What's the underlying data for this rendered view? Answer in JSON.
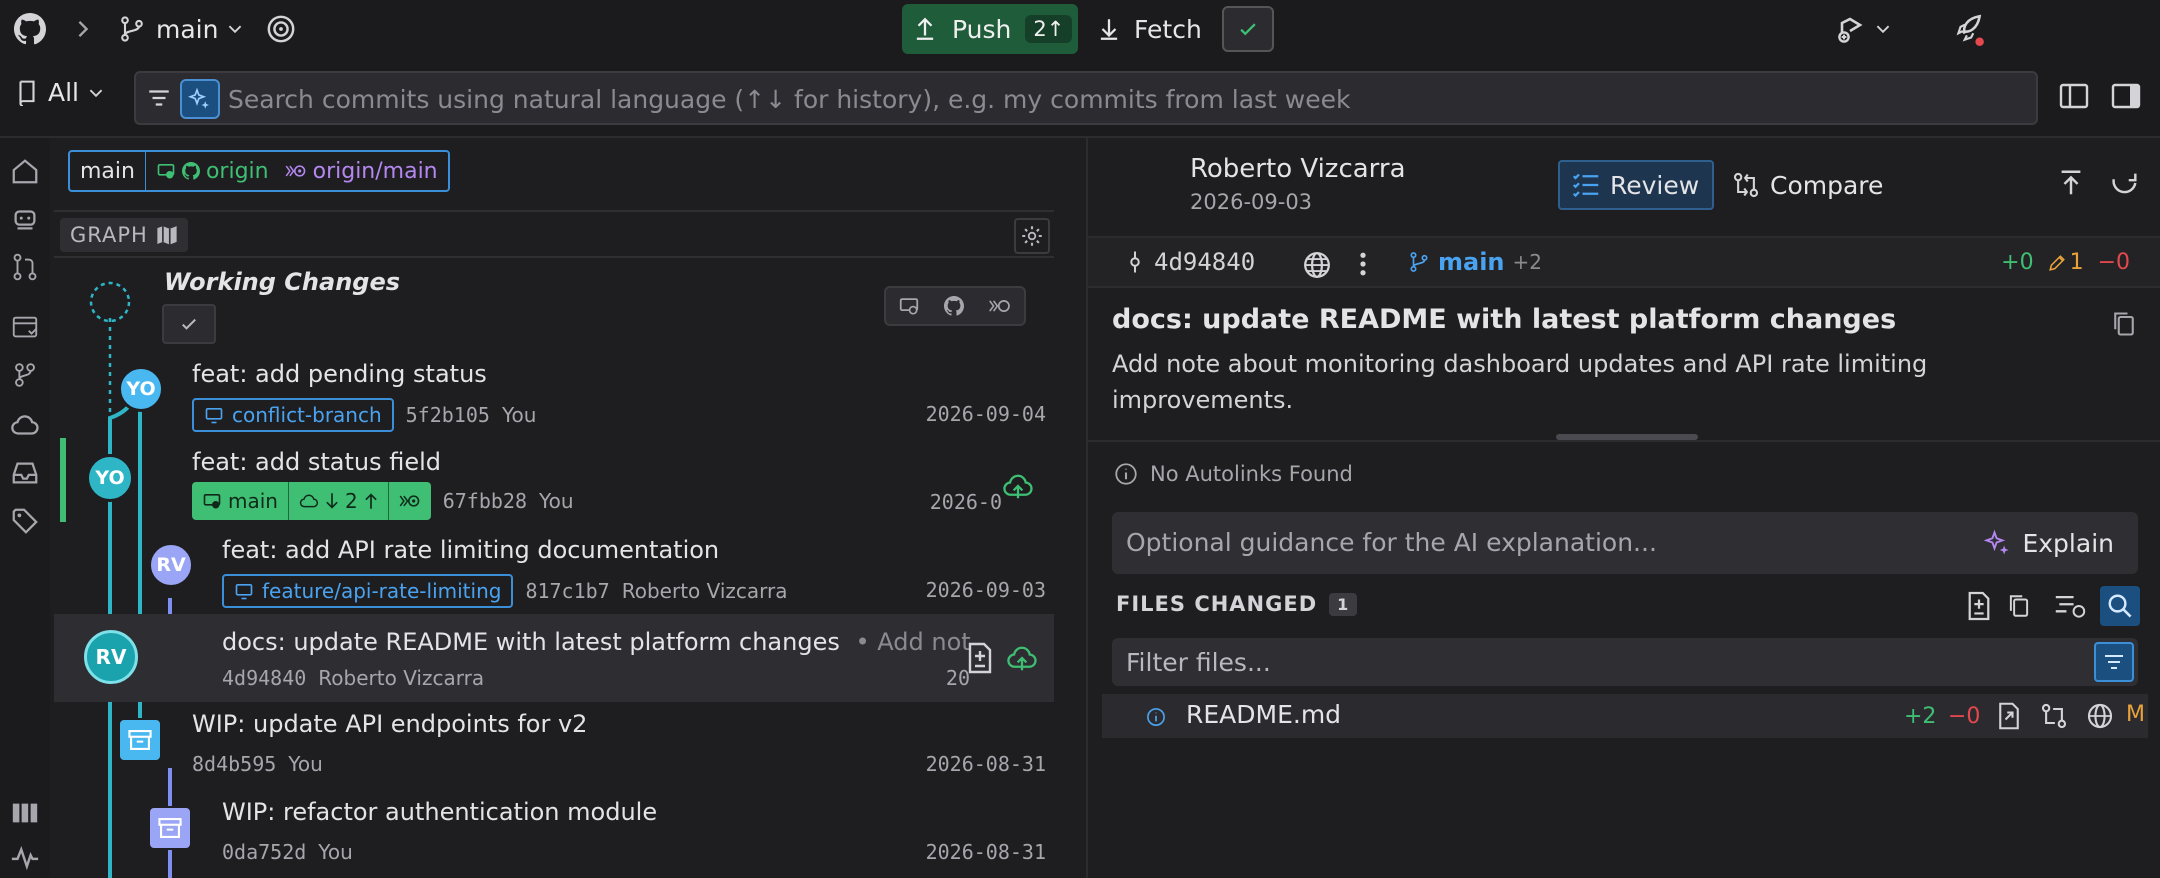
{
  "top_bar": {
    "branch": "main",
    "push_label": "Push",
    "push_count": "2↑",
    "fetch_label": "Fetch"
  },
  "search": {
    "scope": "All",
    "placeholder": "Search commits using natural language (↑↓ for history), e.g. my commits from last week"
  },
  "graph": {
    "branch_chip": {
      "local": "main",
      "remote_name": "origin",
      "remote_branch": "origin/main"
    },
    "header_label": "GRAPH",
    "working_changes_label": "Working Changes",
    "commits": [
      {
        "message": "feat: add pending status",
        "branch": "conflict-branch",
        "sha": "5f2b105",
        "author": "You",
        "date": "2026-09-04",
        "avatar": "YO"
      },
      {
        "message": "feat: add status field",
        "branch": "main",
        "branch_behind": "2",
        "sha": "67fbb28",
        "author": "You",
        "date": "2026-0",
        "avatar": "YO"
      },
      {
        "message": "feat: add API rate limiting documentation",
        "branch": "feature/api-rate-limiting",
        "sha": "817c1b7",
        "author": "Roberto Vizcarra",
        "date": "2026-09-03",
        "avatar": "RV"
      },
      {
        "message": "docs: update README with latest platform changes",
        "suffix": "• Add not",
        "sha": "4d94840",
        "author": "Roberto Vizcarra",
        "date": "20",
        "avatar": "RV"
      },
      {
        "message": "WIP: update API endpoints for v2",
        "sha": "8d4b595",
        "author": "You",
        "date": "2026-08-31"
      },
      {
        "message": "WIP: refactor authentication module",
        "sha": "0da752d",
        "author": "You",
        "date": "2026-08-31"
      }
    ]
  },
  "detail": {
    "author": "Roberto Vizcarra",
    "date": "2026-09-03",
    "review_label": "Review",
    "compare_label": "Compare",
    "sha": "4d94840",
    "branch": "main",
    "branch_more": "+2",
    "stat_added": "0",
    "stat_modified": "1",
    "stat_removed": "0",
    "title": "docs: update README with latest platform changes",
    "body": "Add note about monitoring dashboard updates and API rate limiting improvements.",
    "autolinks": "No Autolinks Found",
    "guidance_placeholder": "Optional guidance for the AI explanation...",
    "explain_label": "Explain",
    "files_changed_label": "FILES CHANGED",
    "files_count": "1",
    "filter_placeholder": "Filter files...",
    "files": [
      {
        "name": "README.md",
        "added": "+2",
        "removed": "−0",
        "status": "M"
      }
    ]
  },
  "colors": {
    "accent_blue": "#3b8fd8",
    "green": "#3ebf73",
    "cyan_lane": "#2fb6c6",
    "purple_lane": "#7f8ff0"
  }
}
